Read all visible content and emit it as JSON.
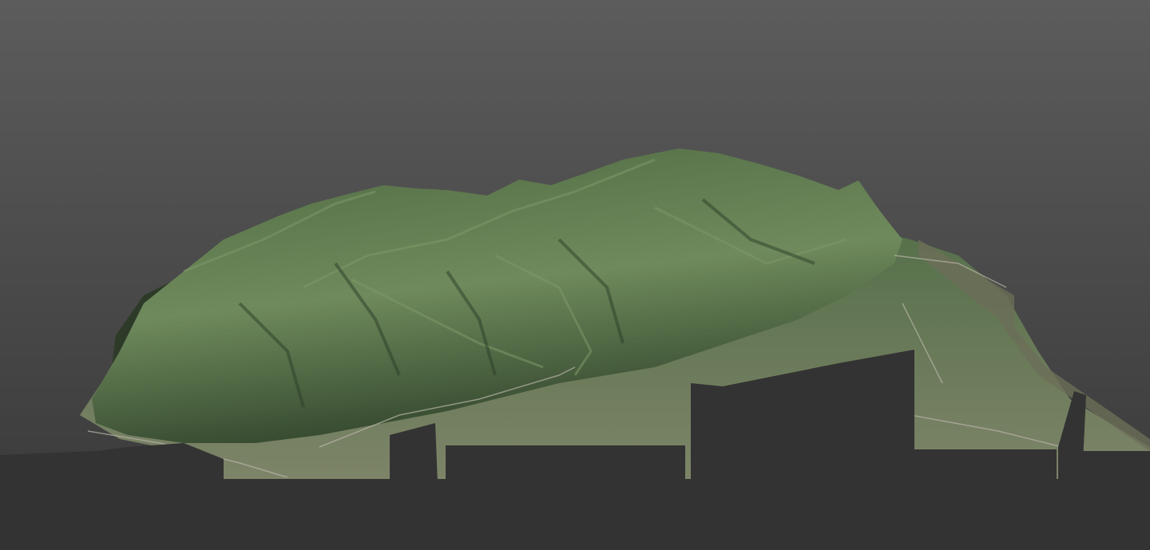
{
  "scene": {
    "colors": {
      "sky_top": "#5c5c5c",
      "sky_bottom": "#383838",
      "ground": "#333333",
      "terrain_light": "#6f8a5c",
      "terrain_mid": "#4f6a42",
      "terrain_dark": "#34482e",
      "valley": "#7d8468",
      "road": "#b8b4a8"
    }
  }
}
